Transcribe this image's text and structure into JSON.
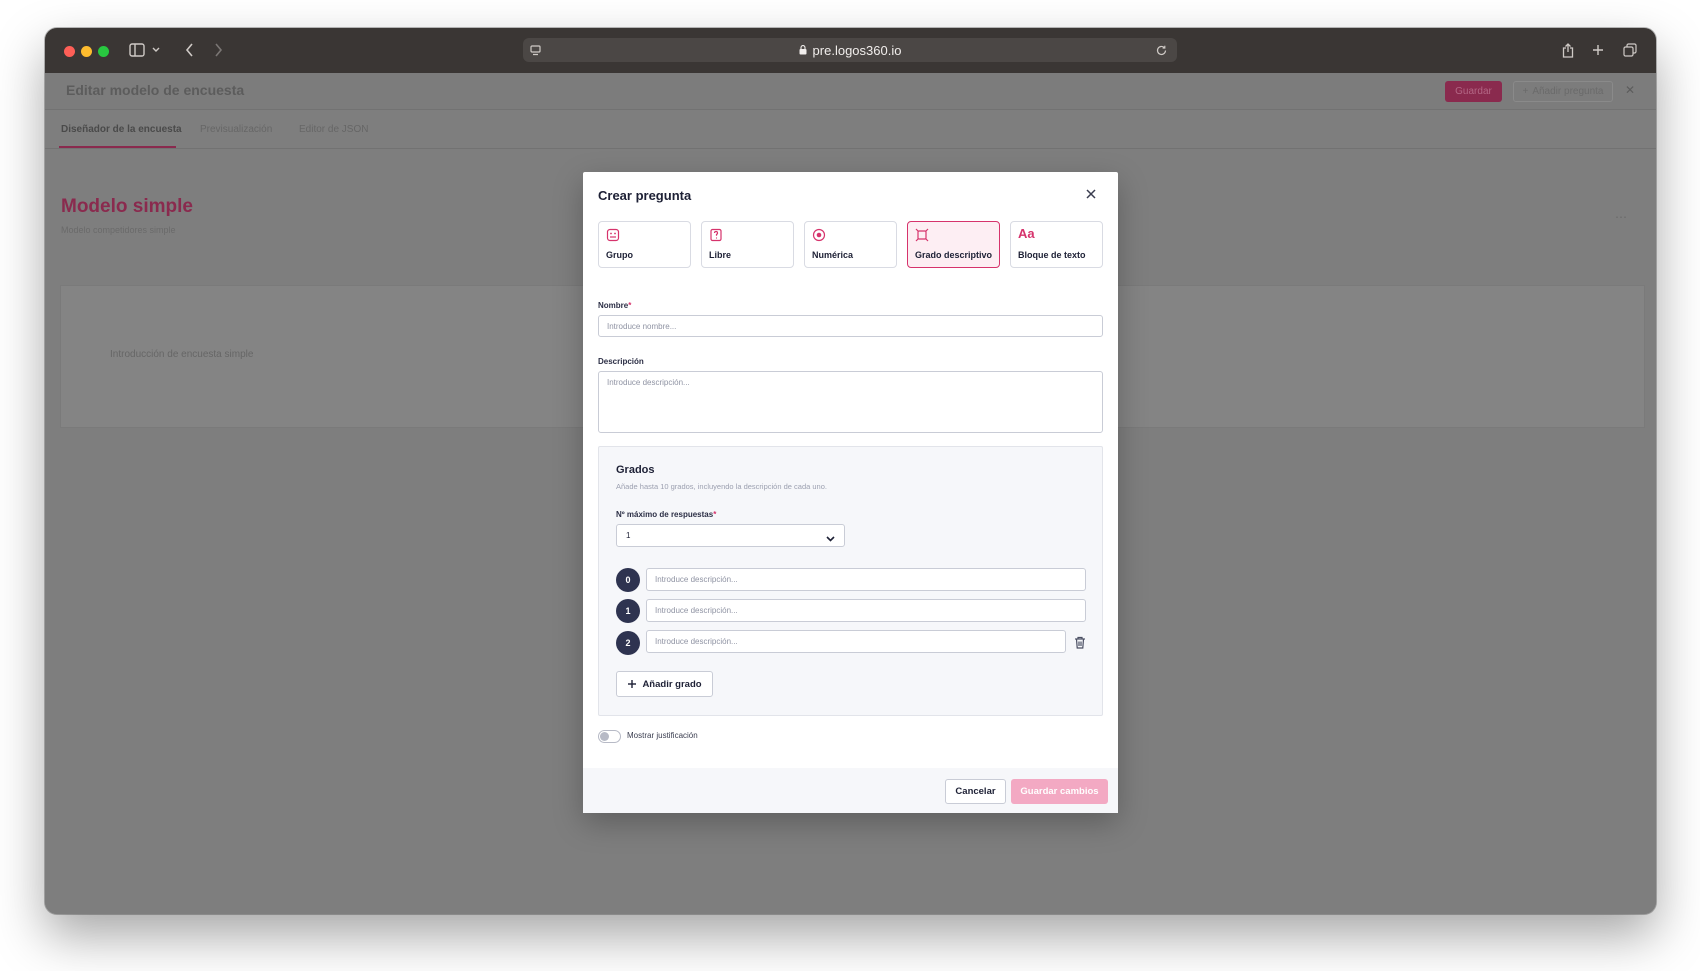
{
  "browser": {
    "url": "pre.logos360.io",
    "icons": [
      "sidebar-icon",
      "chevron-down-icon",
      "back-icon",
      "forward-icon",
      "site-settings-icon",
      "lock-icon",
      "reload-icon",
      "share-icon",
      "new-tab-icon",
      "tabs-overview-icon"
    ]
  },
  "background_app": {
    "title": "Editar modelo de encuesta",
    "primary_button": "Guardar",
    "secondary_button": "Añadir pregunta",
    "tabs": [
      "Diseñador de la encuesta",
      "Previsualización",
      "Editor de JSON"
    ],
    "active_tab": "Diseñador de la encuesta",
    "page_title": "Modelo simple",
    "page_subtitle": "Modelo competidores simple",
    "card_text": "Introducción de encuesta simple"
  },
  "modal": {
    "title": "Crear pregunta",
    "types": [
      {
        "label": "Grupo",
        "icon": "group-icon",
        "selected": false
      },
      {
        "label": "Libre",
        "icon": "free-text-icon",
        "selected": false
      },
      {
        "label": "Numérica",
        "icon": "numeric-icon",
        "selected": false
      },
      {
        "label": "Grado descriptivo",
        "icon": "descriptive-grade-icon",
        "selected": true
      },
      {
        "label": "Bloque de texto",
        "icon": "text-block-icon",
        "selected": false
      }
    ],
    "text_block_glyph": "Aa",
    "nombre": {
      "label": "Nombre",
      "required": "*",
      "value": "",
      "placeholder": "Introduce nombre..."
    },
    "descripcion": {
      "label": "Descripción",
      "value": "",
      "placeholder": "Introduce descripción..."
    },
    "grados": {
      "title": "Grados",
      "help": "Añade hasta 10 grados, incluyendo la descripción de cada uno.",
      "max_label": "Nº máximo de respuestas",
      "required": "*",
      "max_value": "1",
      "items": [
        {
          "number": "0",
          "value": "",
          "placeholder": "Introduce descripción...",
          "deletable": false
        },
        {
          "number": "1",
          "value": "",
          "placeholder": "Introduce descripción...",
          "deletable": false
        },
        {
          "number": "2",
          "value": "",
          "placeholder": "Introduce descripción...",
          "deletable": true
        }
      ],
      "add_label": "Añadir grado"
    },
    "toggle": {
      "label": "Mostrar justificación",
      "on": false
    },
    "footer": {
      "cancel": "Cancelar",
      "save": "Guardar cambios"
    }
  },
  "colors": {
    "accent": "#d6336c",
    "accent_light": "#fdeef3",
    "save_disabled": "#f3a9c3",
    "grade_circle": "#2e3350",
    "overlay": "#7e7e7e"
  }
}
